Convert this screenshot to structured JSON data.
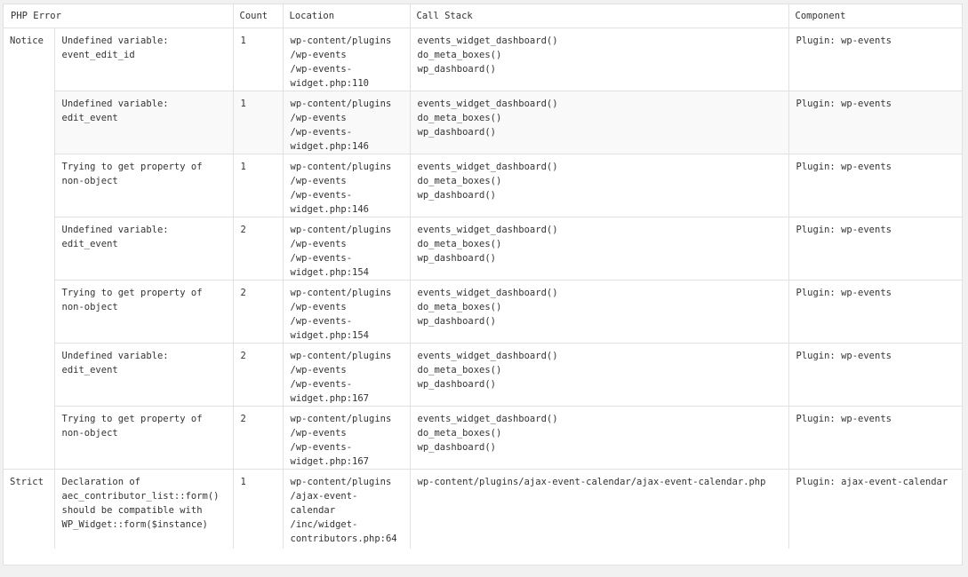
{
  "table": {
    "headers": {
      "php_error": "PHP Error",
      "count": "Count",
      "location": "Location",
      "call_stack": "Call Stack",
      "component": "Component"
    },
    "groups": [
      {
        "type": "Notice",
        "rows": [
          {
            "message": "Undefined variable:\nevent_edit_id",
            "count": "1",
            "location": "wp-content/plugins\n/wp-events\n/wp-events-\nwidget.php:110",
            "call_stack": "events_widget_dashboard()\ndo_meta_boxes()\nwp_dashboard()",
            "component": "Plugin: wp-events"
          },
          {
            "message": "Undefined variable:\nedit_event",
            "count": "1",
            "location": "wp-content/plugins\n/wp-events\n/wp-events-\nwidget.php:146",
            "call_stack": "events_widget_dashboard()\ndo_meta_boxes()\nwp_dashboard()",
            "component": "Plugin: wp-events"
          },
          {
            "message": "Trying to get property of\nnon-object",
            "count": "1",
            "location": "wp-content/plugins\n/wp-events\n/wp-events-\nwidget.php:146",
            "call_stack": "events_widget_dashboard()\ndo_meta_boxes()\nwp_dashboard()",
            "component": "Plugin: wp-events"
          },
          {
            "message": "Undefined variable:\nedit_event",
            "count": "2",
            "location": "wp-content/plugins\n/wp-events\n/wp-events-\nwidget.php:154",
            "call_stack": "events_widget_dashboard()\ndo_meta_boxes()\nwp_dashboard()",
            "component": "Plugin: wp-events"
          },
          {
            "message": "Trying to get property of\nnon-object",
            "count": "2",
            "location": "wp-content/plugins\n/wp-events\n/wp-events-\nwidget.php:154",
            "call_stack": "events_widget_dashboard()\ndo_meta_boxes()\nwp_dashboard()",
            "component": "Plugin: wp-events"
          },
          {
            "message": "Undefined variable:\nedit_event",
            "count": "2",
            "location": "wp-content/plugins\n/wp-events\n/wp-events-\nwidget.php:167",
            "call_stack": "events_widget_dashboard()\ndo_meta_boxes()\nwp_dashboard()",
            "component": "Plugin: wp-events"
          },
          {
            "message": "Trying to get property of\nnon-object",
            "count": "2",
            "location": "wp-content/plugins\n/wp-events\n/wp-events-\nwidget.php:167",
            "call_stack": "events_widget_dashboard()\ndo_meta_boxes()\nwp_dashboard()",
            "component": "Plugin: wp-events"
          }
        ]
      },
      {
        "type": "Strict",
        "rows": [
          {
            "message": "Declaration of\naec_contributor_list::form()\nshould be compatible with\nWP_Widget::form($instance)",
            "count": "1",
            "location": "wp-content/plugins\n/ajax-event-\ncalendar\n/inc/widget-\ncontributors.php:64",
            "call_stack": "wp-content/plugins/ajax-event-calendar/ajax-event-calendar.php",
            "component": "Plugin: ajax-event-calendar"
          }
        ]
      }
    ]
  },
  "colors": {
    "page_bg": "#f1f1f1",
    "table_bg": "#ffffff",
    "alt_row_bg": "#f9f9f9",
    "border": "#e1e1e1",
    "text": "#333333"
  }
}
